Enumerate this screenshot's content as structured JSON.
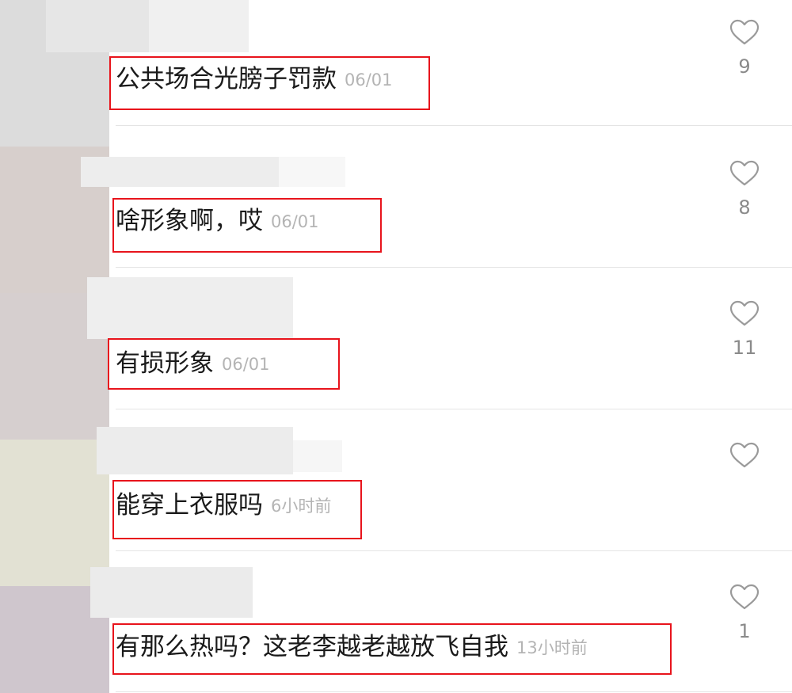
{
  "comments": [
    {
      "text": "公共场合光膀子罚款",
      "time": "06/01",
      "likes": "9"
    },
    {
      "text": "啥形象啊，哎",
      "time": "06/01",
      "likes": "8"
    },
    {
      "text": "有损形象",
      "time": "06/01",
      "likes": "11"
    },
    {
      "text": "能穿上衣服吗",
      "time": "6小时前",
      "likes": ""
    },
    {
      "text": "有那么热吗？这老李越老越放飞自我",
      "time": "13小时前",
      "likes": "1"
    }
  ],
  "colors": {
    "highlight_box": "#e8141c",
    "time_text": "#b4b4b4",
    "like_count": "#8a8a8a",
    "heart_outline": "#9a9a9a"
  },
  "icons": {
    "like": "heart-outline-icon"
  }
}
